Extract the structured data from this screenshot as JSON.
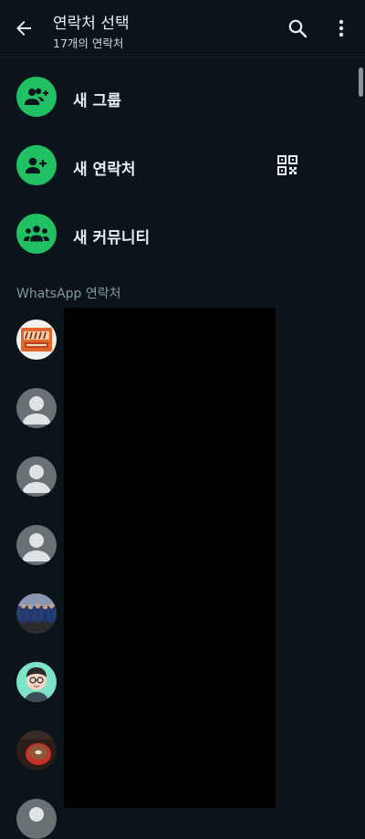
{
  "header": {
    "title": "연락처 선택",
    "subtitle": "17개의 연락처"
  },
  "actions": [
    {
      "label": "새 그룹",
      "icon": "group-add-icon"
    },
    {
      "label": "새 연락처",
      "icon": "person-add-icon"
    },
    {
      "label": "새 커뮤니티",
      "icon": "community-icon"
    }
  ],
  "section": {
    "title": "WhatsApp 연락처"
  },
  "colors": {
    "background": "#0b141a",
    "accent": "#21c063",
    "text_primary": "#e9edef",
    "text_secondary": "#8696a0"
  },
  "contacts": [
    {
      "avatar": "photo-avatar"
    },
    {
      "avatar": "default-avatar"
    },
    {
      "avatar": "default-avatar"
    },
    {
      "avatar": "default-avatar"
    },
    {
      "avatar": "photo-avatar"
    },
    {
      "avatar": "photo-avatar"
    },
    {
      "avatar": "photo-avatar"
    },
    {
      "avatar": "default-avatar"
    }
  ]
}
